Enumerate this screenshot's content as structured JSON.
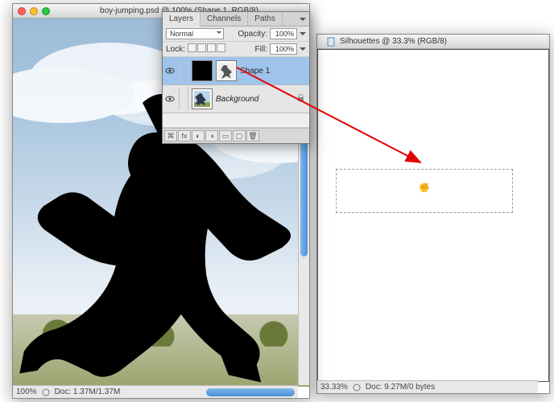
{
  "doc1": {
    "title": "boy-jumping.psd @ 100% (Shape 1, RGB/8)",
    "zoom": "100%",
    "doc_info": "Doc: 1.37M/1.37M"
  },
  "doc2": {
    "title": "Silhouettes @ 33.3% (RGB/8)",
    "zoom": "33.33%",
    "doc_info": "Doc: 9.27M/0 bytes"
  },
  "layers_panel": {
    "tabs": [
      "Layers",
      "Channels",
      "Paths"
    ],
    "blend_mode": "Normal",
    "opacity_label": "Opacity:",
    "opacity_value": "100%",
    "lock_label": "Lock:",
    "fill_label": "Fill:",
    "fill_value": "100%",
    "layers": [
      {
        "name": "Shape 1",
        "selected": true,
        "is_shape": true
      },
      {
        "name": "Background",
        "selected": false,
        "locked": true
      }
    ]
  }
}
